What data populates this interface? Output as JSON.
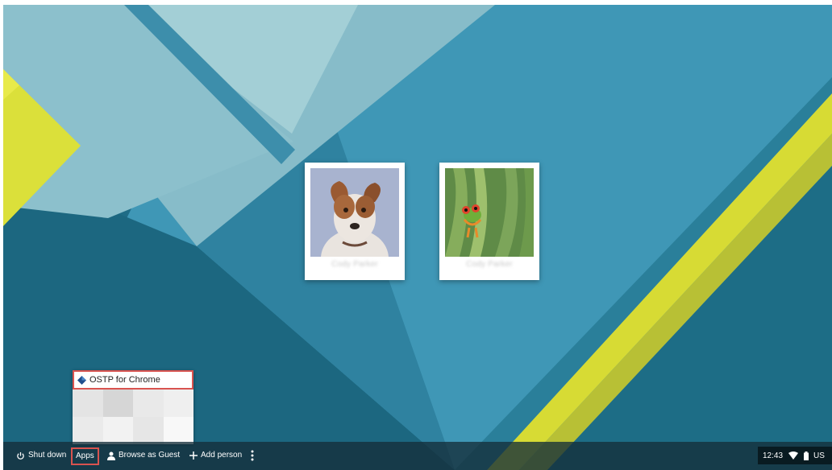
{
  "colors": {
    "wall_base": "#3f97b6",
    "wall_dark": "#1f6c86",
    "wall_light": "#8fc1cd",
    "wall_stripe": "#5198ad",
    "yellow": "#dfe232",
    "highlight": "#d9534f"
  },
  "profiles": [
    {
      "name": "Cody Parker",
      "avatar": "dog-avatar"
    },
    {
      "name": "Cody Parker",
      "avatar": "frog-avatar"
    }
  ],
  "apps_menu": {
    "items": [
      {
        "label": "OSTP for Chrome",
        "icon": "ostp-app-icon"
      }
    ]
  },
  "shelf": {
    "shutdown_label": "Shut down",
    "apps_label": "Apps",
    "guest_label": "Browse as Guest",
    "add_person_label": "Add person",
    "more_icon": "more-vert-icon"
  },
  "status": {
    "time": "12:43",
    "keyboard": "US"
  }
}
